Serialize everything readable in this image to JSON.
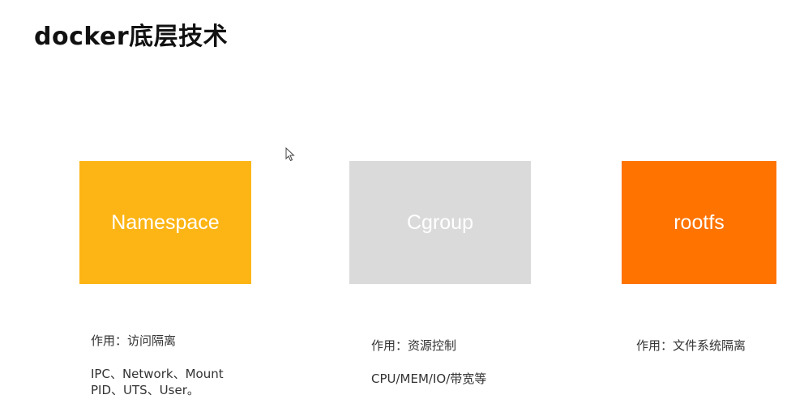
{
  "title": "docker底层技术",
  "colors": {
    "namespace": "#FDB515",
    "cgroup": "#DADADA",
    "rootfs": "#FF7300"
  },
  "boxes": [
    {
      "label": "Namespace",
      "purpose": "作用：访问隔离",
      "detail_lines": [
        "IPC、Network、Mount",
        "PID、UTS、User。"
      ]
    },
    {
      "label": "Cgroup",
      "purpose": "作用：资源控制",
      "detail_lines": [
        "CPU/MEM/IO/带宽等"
      ]
    },
    {
      "label": "rootfs",
      "purpose": "作用：文件系统隔离",
      "detail_lines": []
    }
  ]
}
